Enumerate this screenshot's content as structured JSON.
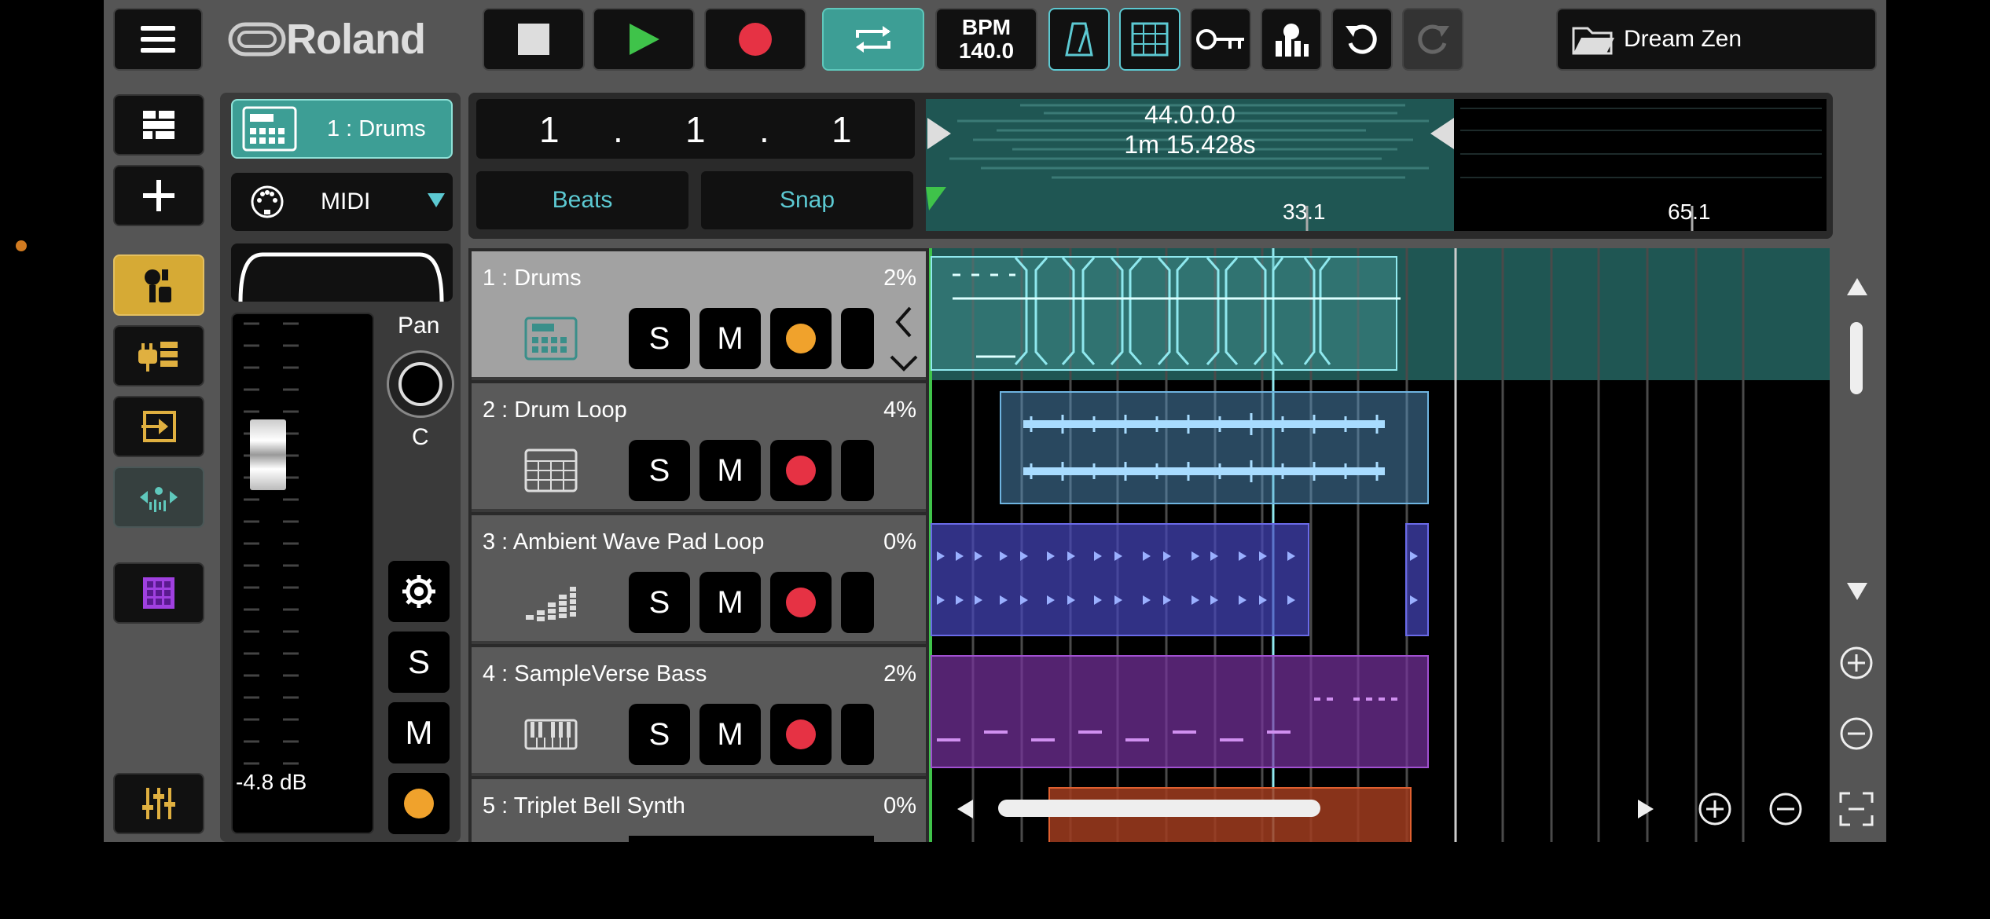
{
  "toolbar": {
    "logo": "Roland",
    "bpm_label": "BPM",
    "bpm_value": "140.0",
    "project_name": "Dream Zen"
  },
  "inspector": {
    "track_label": "1 : Drums",
    "input_label": "MIDI",
    "pan_label": "Pan",
    "pan_value": "C",
    "volume_db": "-4.8 dB",
    "solo": "S",
    "mute": "M"
  },
  "transport": {
    "pos_bar": "1",
    "pos_beat": "1",
    "pos_tick": "1",
    "sep": ".",
    "beats_label": "Beats",
    "snap_label": "Snap"
  },
  "ruler": {
    "position": "44.0.0.0",
    "time": "1m 15.428s",
    "marks": [
      "33.1",
      "65.1"
    ]
  },
  "tracks": [
    {
      "name": "1 : Drums",
      "percent": "2%",
      "solo": "S",
      "mute": "M",
      "icon": "drum-machine-icon",
      "rec": "#f0a22c"
    },
    {
      "name": "2 : Drum Loop",
      "percent": "4%",
      "solo": "S",
      "mute": "M",
      "icon": "grid-pad-icon",
      "rec": "#e63244"
    },
    {
      "name": "3 : Ambient Wave Pad Loop",
      "percent": "0%",
      "solo": "S",
      "mute": "M",
      "icon": "bars-icon",
      "rec": "#e63244"
    },
    {
      "name": "4 : SampleVerse Bass",
      "percent": "2%",
      "solo": "S",
      "mute": "M",
      "icon": "keyboard-icon",
      "rec": "#e63244"
    },
    {
      "name": "5 : Triplet Bell Synth",
      "percent": "0%"
    }
  ],
  "colors": {
    "teal": "#5fc8bc",
    "cyan": "#5cc9d2",
    "gold": "#d6aa35",
    "record_red": "#e63244",
    "record_orange": "#f0a22c",
    "play_green": "#3fc34a"
  }
}
